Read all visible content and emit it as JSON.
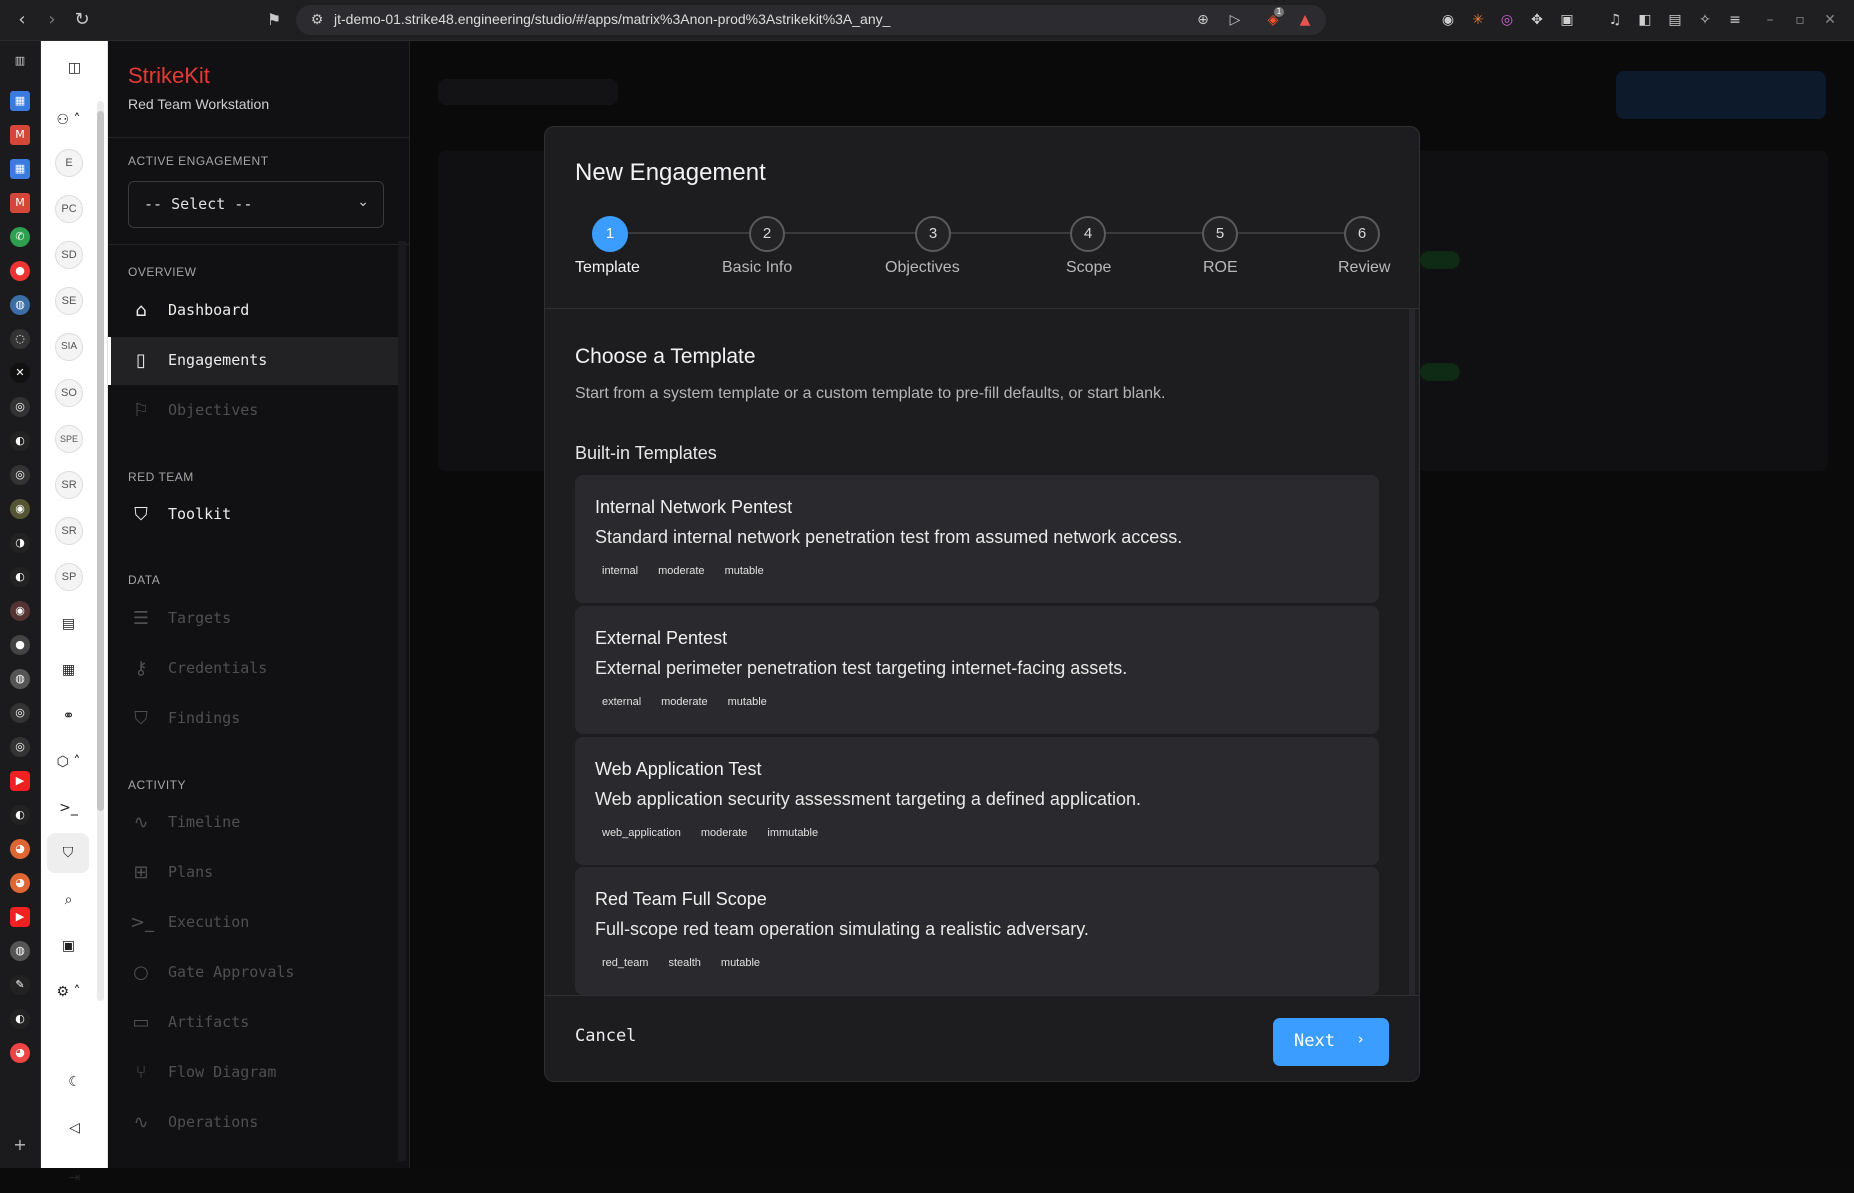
{
  "browser": {
    "url": "jt-demo-01.strike48.engineering/studio/#/apps/matrix%3Anon-prod%3Astrikekit%3A_any_",
    "shield_badge": "1"
  },
  "rail": {
    "badges": [
      "E",
      "PC",
      "SD",
      "SE",
      "SIA",
      "SO",
      "SPE",
      "SR",
      "SR",
      "SP"
    ]
  },
  "sidebar": {
    "brand": "StrikeKit",
    "subtitle": "Red Team Workstation",
    "active_engagement_label": "ACTIVE ENGAGEMENT",
    "select_value": "-- Select --",
    "sections": {
      "overview": "OVERVIEW",
      "red_team": "RED TEAM",
      "data": "DATA",
      "activity": "ACTIVITY"
    },
    "items": {
      "dashboard": "Dashboard",
      "engagements": "Engagements",
      "objectives": "Objectives",
      "toolkit": "Toolkit",
      "targets": "Targets",
      "credentials": "Credentials",
      "findings": "Findings",
      "timeline": "Timeline",
      "plans": "Plans",
      "execution": "Execution",
      "gate_approvals": "Gate Approvals",
      "artifacts": "Artifacts",
      "flow_diagram": "Flow Diagram",
      "operations": "Operations"
    }
  },
  "modal": {
    "title": "New Engagement",
    "steps": [
      {
        "num": "1",
        "label": "Template"
      },
      {
        "num": "2",
        "label": "Basic Info"
      },
      {
        "num": "3",
        "label": "Objectives"
      },
      {
        "num": "4",
        "label": "Scope"
      },
      {
        "num": "5",
        "label": "ROE"
      },
      {
        "num": "6",
        "label": "Review"
      }
    ],
    "active_step": 1,
    "section_title": "Choose a Template",
    "section_desc": "Start from a system template or a custom template to pre-fill defaults, or start blank.",
    "builtin_label": "Built-in Templates",
    "templates": [
      {
        "name": "Internal Network Pentest",
        "desc": "Standard internal network penetration test from assumed network access.",
        "tags": [
          "internal",
          "moderate",
          "mutable"
        ]
      },
      {
        "name": "External Pentest",
        "desc": "External perimeter penetration test targeting internet-facing assets.",
        "tags": [
          "external",
          "moderate",
          "mutable"
        ]
      },
      {
        "name": "Web Application Test",
        "desc": "Web application security assessment targeting a defined application.",
        "tags": [
          "web_application",
          "moderate",
          "immutable"
        ]
      },
      {
        "name": "Red Team Full Scope",
        "desc": "Full-scope red team operation simulating a realistic adversary.",
        "tags": [
          "red_team",
          "stealth",
          "mutable"
        ]
      }
    ],
    "cancel_label": "Cancel",
    "next_label": "Next"
  },
  "colors": {
    "brand": "#e53935",
    "accent": "#3b9dff",
    "modal_bg": "#1d1d20",
    "card_bg": "#2a2a2e"
  }
}
